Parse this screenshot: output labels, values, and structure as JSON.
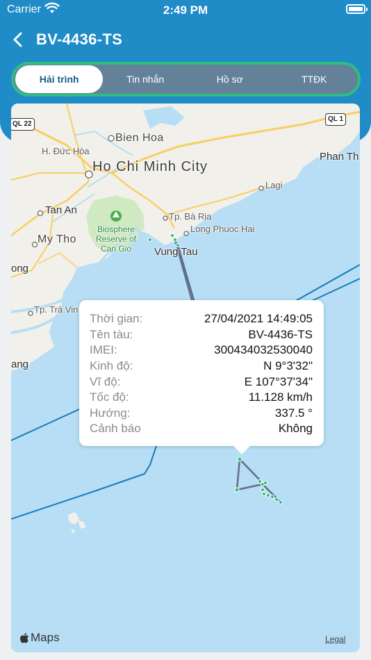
{
  "status_bar": {
    "carrier": "Carrier",
    "time": "2:49 PM"
  },
  "header": {
    "title": "BV-4436-TS"
  },
  "tabs": [
    {
      "label": "Hải trình",
      "active": true
    },
    {
      "label": "Tin nhắn",
      "active": false
    },
    {
      "label": "Hồ sơ",
      "active": false
    },
    {
      "label": "TTĐK",
      "active": false
    }
  ],
  "map": {
    "places": {
      "bien_hoa": "Bien Hoa",
      "duc_hoa": "H. Đức Hòa",
      "hcmc": "Ho Chi Minh City",
      "tan_an": "Tan An",
      "my_tho": "My Tho",
      "biosphere": "Biosphere Reserve of Can Gio",
      "ba_ria": "Tp. Bà Rịa",
      "long_phuoc_hai": "Long Phuoc Hai",
      "vung_tau": "Vung Tau",
      "lagi": "Lagi",
      "phan_thiet": "Phan Th",
      "tra_vinh": "Tp. Trà Vin",
      "ong": "ong",
      "ang": "ang"
    },
    "shields": {
      "ql22": "QL 22",
      "ql1": "QL 1"
    },
    "attribution": "Maps",
    "legal": "Legal"
  },
  "popup": {
    "rows": [
      {
        "label": "Thời gian:",
        "value": "27/04/2021 14:49:05"
      },
      {
        "label": "Tên tàu:",
        "value": "BV-4436-TS"
      },
      {
        "label": "IMEI:",
        "value": "300434032530040"
      },
      {
        "label": "Kinh độ:",
        "value": "N 9°3'32\""
      },
      {
        "label": "Vĩ độ:",
        "value": "E 107°37'34\""
      },
      {
        "label": "Tốc độ:",
        "value": "11.128 km/h"
      },
      {
        "label": "Hướng:",
        "value": "337.5 °"
      },
      {
        "label": "Cảnh báo",
        "value": "Không"
      }
    ]
  },
  "colors": {
    "header": "#1f8bc7",
    "tab_border": "#2ebd83",
    "tab_bg": "#64819a",
    "sea": "#b7def4",
    "land": "#f2f0ea",
    "route": "#5f6f86",
    "marker": "#2ebd83"
  }
}
